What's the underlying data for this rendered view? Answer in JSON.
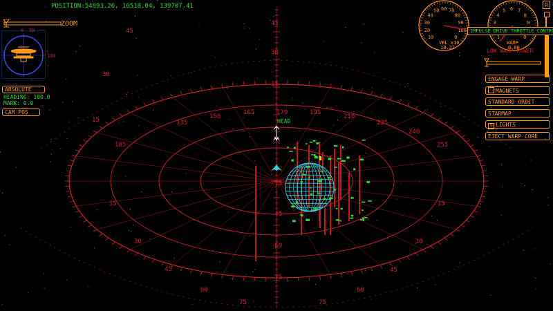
{
  "hud": {
    "position": "POSITION:54893.26, 16518.04, 139707.41",
    "zoom_label": "ZOOM",
    "absolute_label": "ABSOLUTE",
    "heading": "HEADING: 180.0",
    "mark": "MARK: 0.0",
    "cam_pos_label": "CAM POS",
    "head_marker": "HEAD",
    "minimap_numbers": [
      "0",
      "50",
      "180"
    ]
  },
  "gauges": {
    "impulse": {
      "ticks": [
        "10",
        "20",
        "30",
        "40",
        "50",
        "60",
        "70",
        "80",
        "90",
        "100",
        "0"
      ],
      "readout_label": "VEL x10",
      "readout_value": "10.21"
    },
    "warp": {
      "ticks": [
        "1",
        "2",
        "3",
        "4",
        "5",
        "6",
        "7",
        "8",
        "9",
        "10",
        "0"
      ],
      "readout_label": "WARP",
      "readout_value": "0.00"
    },
    "r_label": "R",
    "tooltip": "IMPULSE DRIVE THROTTLE CONTROL"
  },
  "controls": {
    "low_warp_power": "LOW WARP POWER",
    "buttons": [
      {
        "label": "ENGAGE WARP",
        "checkbox": false,
        "checked": false
      },
      {
        "label": "MAGNETS",
        "checkbox": true,
        "checked": false
      },
      {
        "label": "STANDARD ORBIT",
        "checkbox": false,
        "checked": false
      },
      {
        "label": "STARMAP",
        "checkbox": false,
        "checked": false
      },
      {
        "label": "LIGHTS",
        "checkbox": true,
        "checked": true
      },
      {
        "label": "EJECT WARP CORE",
        "checkbox": false,
        "checked": false
      }
    ]
  },
  "grid": {
    "bearing_labels": [
      "135",
      "150",
      "165",
      "179",
      "195",
      "210",
      "225",
      "240",
      "255",
      "105"
    ],
    "pitch_labels": [
      "45",
      "30",
      "15",
      "0",
      "-15",
      "-30",
      "-45",
      "-60",
      "-75"
    ],
    "ring_labels": [
      "45",
      "30",
      "15",
      "15",
      "30",
      "45",
      "60",
      "75",
      "75",
      "60",
      "45",
      "30",
      "15"
    ]
  },
  "colors": {
    "grid": "#d0202a",
    "planet": "#2fd0e0",
    "hud": "#ff9a1a",
    "text": "#2bdc3a"
  }
}
